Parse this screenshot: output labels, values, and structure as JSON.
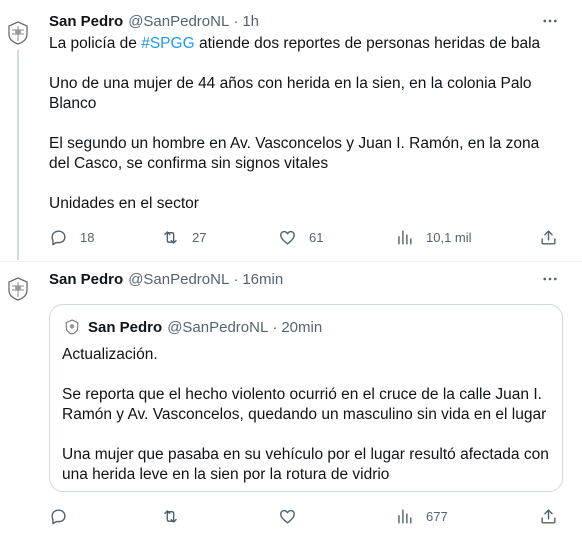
{
  "tweets": [
    {
      "author_name": "San Pedro",
      "handle": "@SanPedroNL",
      "separator": "·",
      "time": "1h",
      "text_prefix": "La policía de ",
      "hashtag": "#SPGG",
      "text_suffix": " atiende dos reportes de personas heridas de bala",
      "paragraph_2": "Uno de una mujer de 44 años con herida en la sien, en la colonia Palo Blanco",
      "paragraph_3": "El segundo un hombre en Av. Vasconcelos y Juan I. Ramón, en la zona del Casco, se confirma sin signos vitales",
      "paragraph_4": "Unidades en el sector",
      "replies": "18",
      "retweets": "27",
      "likes": "61",
      "views": "10,1 mil"
    },
    {
      "author_name": "San Pedro",
      "handle": "@SanPedroNL",
      "separator": "·",
      "time": "16min",
      "replies": "",
      "retweets": "",
      "likes": "",
      "views": "677",
      "quote": {
        "author_name": "San Pedro",
        "handle": "@SanPedroNL",
        "separator": "·",
        "time": "20min",
        "paragraph_1": "Actualización.",
        "paragraph_2": "Se reporta que el hecho violento ocurrió en el cruce de la calle Juan I. Ramón y Av. Vasconcelos, quedando un masculino sin vida en el lugar",
        "paragraph_3": "Una mujer que pasaba en su vehículo por el lugar resultó afectada con una herida leve en la sien por la rotura de vidrio"
      }
    }
  ],
  "icons": {
    "avatar": "municipal-seal-icon",
    "more": "more-horizontal-icon",
    "reply": "reply-icon",
    "retweet": "retweet-icon",
    "like": "heart-icon",
    "views": "views-bar-chart-icon",
    "share": "share-icon"
  },
  "colors": {
    "text": "#0f1419",
    "secondary": "#536471",
    "accent": "#1d9bf0",
    "border": "#cfd9de"
  }
}
